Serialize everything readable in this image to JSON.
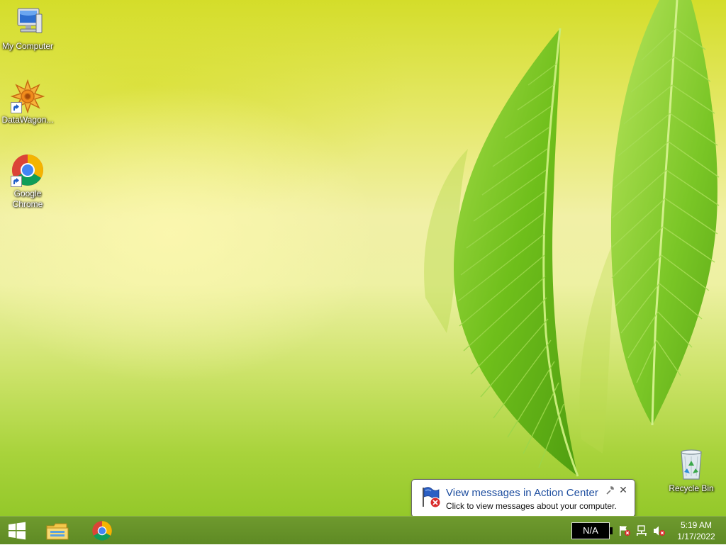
{
  "desktop": {
    "icons": [
      {
        "label": "My Computer",
        "icon": "computer-icon"
      },
      {
        "label": "DataWagon...",
        "icon": "datawagon-icon"
      },
      {
        "label": "Google Chrome",
        "icon": "chrome-icon"
      },
      {
        "label": "Recycle Bin",
        "icon": "recycle-bin-icon"
      }
    ]
  },
  "taskbar": {
    "start_icon": "windows-logo-icon",
    "pinned": [
      {
        "name": "File Explorer",
        "icon": "file-explorer-icon"
      },
      {
        "name": "Google Chrome",
        "icon": "chrome-icon"
      }
    ],
    "battery_text": "N/A",
    "tray_icons": [
      "action-center-flag-icon",
      "network-icon",
      "volume-muted-icon"
    ],
    "clock": {
      "time": "5:19 AM",
      "date": "1/17/2022"
    }
  },
  "notification": {
    "title": "View messages in Action Center",
    "message": "Click to view messages about your computer.",
    "icon": "action-center-flag-error-icon",
    "close_glyph": "✕"
  },
  "colors": {
    "taskbar": "#5e8a24",
    "notification_title": "#1f4fa0",
    "wallpaper_leaf": "#7cc21e"
  }
}
